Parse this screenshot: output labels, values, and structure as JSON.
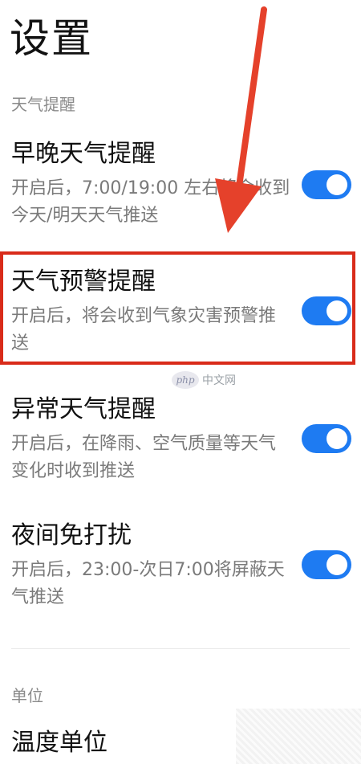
{
  "page_title": "设置",
  "sections": [
    {
      "label": "天气提醒",
      "items": [
        {
          "title": "早晚天气提醒",
          "desc": "开启后，7:00/19:00 左右将会收到今天/明天天气推送",
          "enabled": true
        },
        {
          "title": "天气预警提醒",
          "desc": "开启后，将会收到气象灾害预警推送",
          "enabled": true
        },
        {
          "title": "异常天气提醒",
          "desc": "开启后，在降雨、空气质量等天气变化时收到推送",
          "enabled": true
        },
        {
          "title": "夜间免打扰",
          "desc": "开启后，23:00-次日7:00将屏蔽天气推送",
          "enabled": true
        }
      ]
    },
    {
      "label": "单位",
      "items": [
        {
          "title": "温度单位"
        }
      ]
    }
  ],
  "watermark": {
    "badge": "php",
    "text": "中文网"
  },
  "colors": {
    "toggle_on": "#1e7bf2",
    "highlight_box": "#d92b1a",
    "arrow": "#e5412b"
  }
}
